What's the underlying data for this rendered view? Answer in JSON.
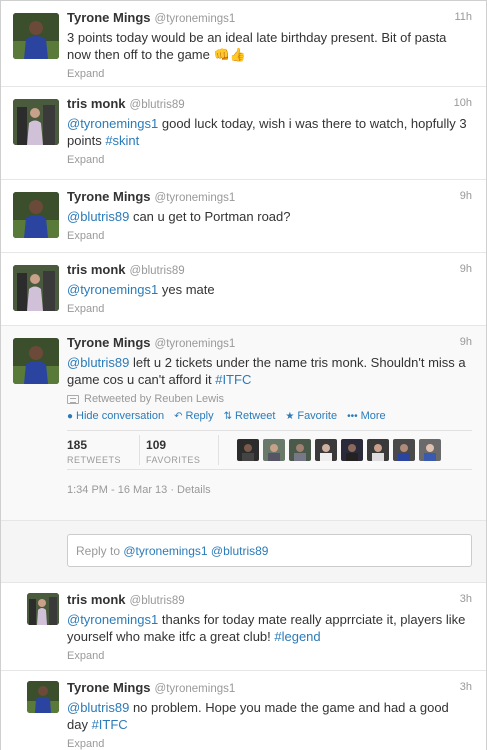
{
  "tweets": [
    {
      "fullname": "Tyrone Mings",
      "username": "@tyronemings1",
      "time": "11h",
      "text": "3 points today would be an ideal late birthday present. Bit of pasta now then off to the game 👊👍",
      "expand": "Expand"
    },
    {
      "fullname": "tris monk",
      "username": "@blutris89",
      "time": "10h",
      "mention": "@tyronemings1",
      "text": " good luck today, wish i was there to watch, hopfully 3 points ",
      "hashtag": "#skint",
      "expand": "Expand"
    },
    {
      "fullname": "Tyrone Mings",
      "username": "@tyronemings1",
      "time": "9h",
      "mention": "@blutris89",
      "text": " can u get to Portman road?",
      "expand": "Expand"
    },
    {
      "fullname": "tris monk",
      "username": "@blutris89",
      "time": "9h",
      "mention": "@tyronemings1",
      "text": " yes mate",
      "expand": "Expand"
    }
  ],
  "main_tweet": {
    "fullname": "Tyrone Mings",
    "username": "@tyronemings1",
    "time": "9h",
    "mention": "@blutris89",
    "text": " left u 2 tickets under the name tris monk. Shouldn't miss a game cos u can't afford it ",
    "hashtag": "#ITFC",
    "retweeted_by": "Retweeted by Reuben Lewis",
    "actions": {
      "hide": "Hide conversation",
      "reply": "Reply",
      "retweet": "Retweet",
      "favorite": "Favorite",
      "more": "More"
    },
    "retweets": "185",
    "retweets_label": "RETWEETS",
    "favorites": "109",
    "favorites_label": "FAVORITES",
    "meta": "1:34 PM - 16 Mar 13 · Details"
  },
  "reply_box": {
    "prefix": "Reply to ",
    "mention1": "@tyronemings1",
    "mention2": "@blutris89"
  },
  "replies": [
    {
      "fullname": "tris monk",
      "username": "@blutris89",
      "time": "3h",
      "mention": "@tyronemings1",
      "text": " thanks for today mate really apprrciate it, players like yourself who make itfc a great club! ",
      "hashtag": "#legend",
      "expand": "Expand"
    },
    {
      "fullname": "Tyrone Mings",
      "username": "@tyronemings1",
      "time": "3h",
      "mention": "@blutris89",
      "text": " no problem. Hope you made the game and had a good day ",
      "hashtag": "#ITFC",
      "expand": "Expand"
    }
  ],
  "colors": {
    "link": "#2b7bb9",
    "muted": "#999999",
    "text": "#333333"
  }
}
